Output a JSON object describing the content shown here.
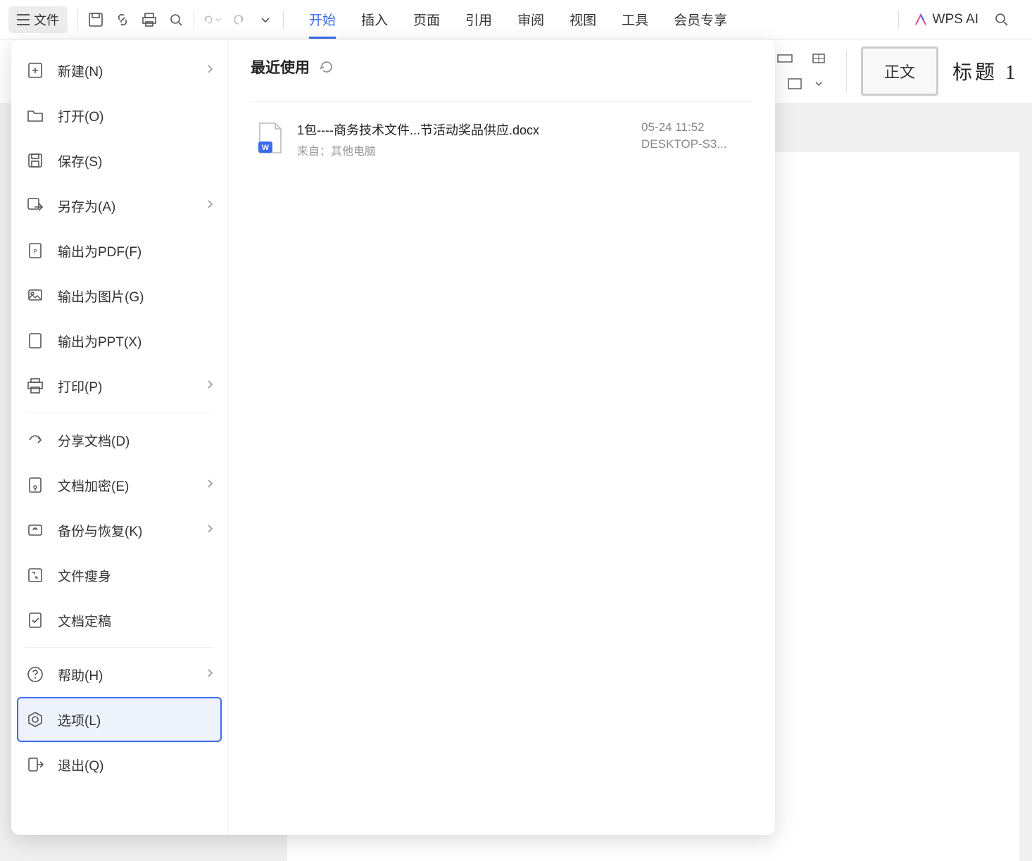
{
  "toolbar": {
    "file_label": "文件",
    "tabs": [
      "开始",
      "插入",
      "页面",
      "引用",
      "审阅",
      "视图",
      "工具",
      "会员专享"
    ],
    "wps_ai": "WPS AI"
  },
  "styles": {
    "normal": "正文",
    "heading1": "标题 1"
  },
  "file_menu": {
    "items": [
      {
        "label": "新建(N)",
        "icon": "new-icon",
        "chevron": true
      },
      {
        "label": "打开(O)",
        "icon": "open-icon",
        "chevron": false
      },
      {
        "label": "保存(S)",
        "icon": "save-icon",
        "chevron": false
      },
      {
        "label": "另存为(A)",
        "icon": "saveas-icon",
        "chevron": true
      },
      {
        "label": "输出为PDF(F)",
        "icon": "pdf-icon",
        "chevron": false
      },
      {
        "label": "输出为图片(G)",
        "icon": "image-export-icon",
        "chevron": false
      },
      {
        "label": "输出为PPT(X)",
        "icon": "ppt-export-icon",
        "chevron": false
      },
      {
        "label": "打印(P)",
        "icon": "print-icon",
        "chevron": true
      },
      {
        "divider": true
      },
      {
        "label": "分享文档(D)",
        "icon": "share-icon",
        "chevron": false
      },
      {
        "label": "文档加密(E)",
        "icon": "encrypt-icon",
        "chevron": true
      },
      {
        "label": "备份与恢复(K)",
        "icon": "backup-icon",
        "chevron": true
      },
      {
        "label": "文件瘦身",
        "icon": "compress-icon",
        "chevron": false
      },
      {
        "label": "文档定稿",
        "icon": "finalize-icon",
        "chevron": false
      },
      {
        "divider": true
      },
      {
        "label": "帮助(H)",
        "icon": "help-icon",
        "chevron": true
      },
      {
        "label": "选项(L)",
        "icon": "options-icon",
        "chevron": false,
        "selected": true
      },
      {
        "label": "退出(Q)",
        "icon": "exit-icon",
        "chevron": false
      }
    ]
  },
  "recent": {
    "title": "最近使用",
    "files": [
      {
        "name": "1包----商务技术文件...节活动奖品供应.docx",
        "source": "来自：其他电脑",
        "time": "05-24 11:52",
        "device": "DESKTOP-S3..."
      }
    ]
  }
}
